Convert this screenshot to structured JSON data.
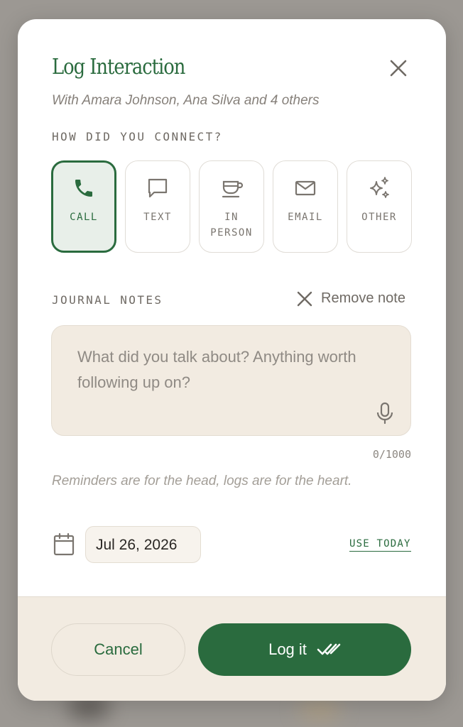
{
  "modal": {
    "title": "Log Interaction",
    "subtitle": "With Amara Johnson, Ana Silva and 4 others",
    "close_icon": "close-icon"
  },
  "connect": {
    "label": "HOW DID YOU CONNECT?",
    "selected": "call",
    "options": [
      {
        "id": "call",
        "label": "CALL",
        "icon": "phone-icon"
      },
      {
        "id": "text",
        "label": "TEXT",
        "icon": "chat-bubble-icon"
      },
      {
        "id": "in_person",
        "label": "IN PERSON",
        "icon": "coffee-cup-icon"
      },
      {
        "id": "email",
        "label": "EMAIL",
        "icon": "envelope-icon"
      },
      {
        "id": "other",
        "label": "OTHER",
        "icon": "sparkles-icon"
      }
    ]
  },
  "notes": {
    "label": "JOURNAL NOTES",
    "remove_label": "Remove note",
    "placeholder": "What did you talk about? Anything worth following up on?",
    "value": "",
    "counter": "0/1000",
    "mic_icon": "microphone-icon"
  },
  "quote": "Reminders are for the head, logs are for the heart.",
  "date": {
    "value": "Jul 26, 2026",
    "use_today_label": "USE TODAY",
    "icon": "calendar-icon"
  },
  "footer": {
    "cancel_label": "Cancel",
    "submit_label": "Log it",
    "submit_icon": "double-check-icon"
  },
  "colors": {
    "accent": "#2a6b3e",
    "selected_bg": "#e8efe9",
    "notes_bg": "#f2ebe1",
    "muted_text": "#86807a"
  }
}
